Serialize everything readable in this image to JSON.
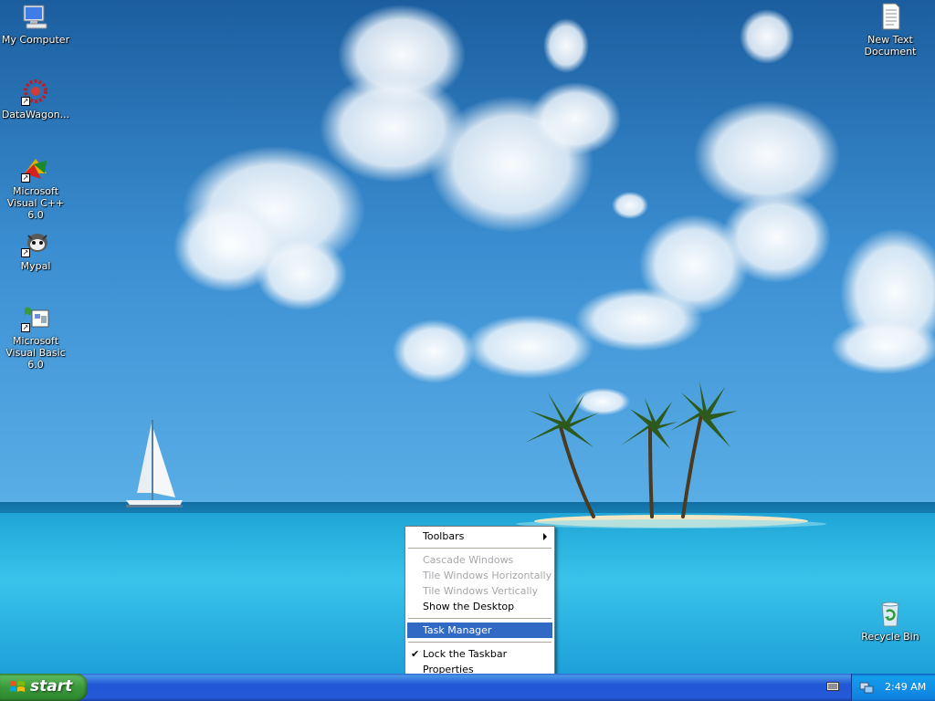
{
  "desktop": {
    "icons_left": [
      {
        "id": "my-computer",
        "label": "My Computer",
        "icon": "computer-icon"
      },
      {
        "id": "datawagon",
        "label": "DataWagon...",
        "icon": "datawagon-icon"
      },
      {
        "id": "msvc",
        "label": "Microsoft Visual C++ 6.0",
        "icon": "visual-cpp-icon"
      },
      {
        "id": "mypal",
        "label": "Mypal",
        "icon": "mypal-icon"
      },
      {
        "id": "msvb",
        "label": "Microsoft Visual Basic 6.0",
        "icon": "visual-basic-icon"
      }
    ],
    "icon_new_text": {
      "label": "New Text Document",
      "icon": "text-document-icon"
    },
    "icon_recycle": {
      "label": "Recycle Bin",
      "icon": "recycle-bin-icon"
    }
  },
  "context_menu": {
    "items": [
      {
        "label": "Toolbars",
        "state": "normal",
        "submenu": true
      },
      {
        "label": "Cascade Windows",
        "state": "disabled"
      },
      {
        "label": "Tile Windows Horizontally",
        "state": "disabled"
      },
      {
        "label": "Tile Windows Vertically",
        "state": "disabled"
      },
      {
        "label": "Show the Desktop",
        "state": "normal"
      },
      {
        "label": "Task Manager",
        "state": "selected"
      },
      {
        "label": "Lock the Taskbar",
        "state": "checked"
      },
      {
        "label": "Properties",
        "state": "normal"
      }
    ]
  },
  "taskbar": {
    "start_label": "start",
    "clock": "2:49 AM",
    "colors": {
      "taskbar": "#245edb",
      "start": "#3c9a3c",
      "tray": "#0f8be3",
      "menu_highlight": "#316ac5"
    }
  }
}
